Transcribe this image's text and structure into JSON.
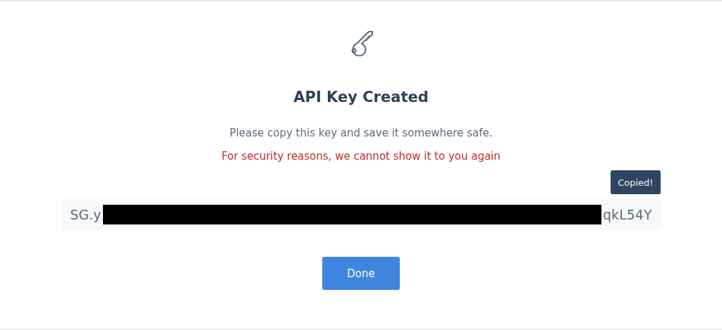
{
  "dialog": {
    "title": "API Key Created",
    "message": "Please copy this key and save it somewhere safe.",
    "warning": "For security reasons, we cannot show it to you again",
    "tooltip": "Copied!",
    "key": {
      "start": "SG.y",
      "end": "qkL54Y",
      "redacted": true
    },
    "button": "Done"
  }
}
